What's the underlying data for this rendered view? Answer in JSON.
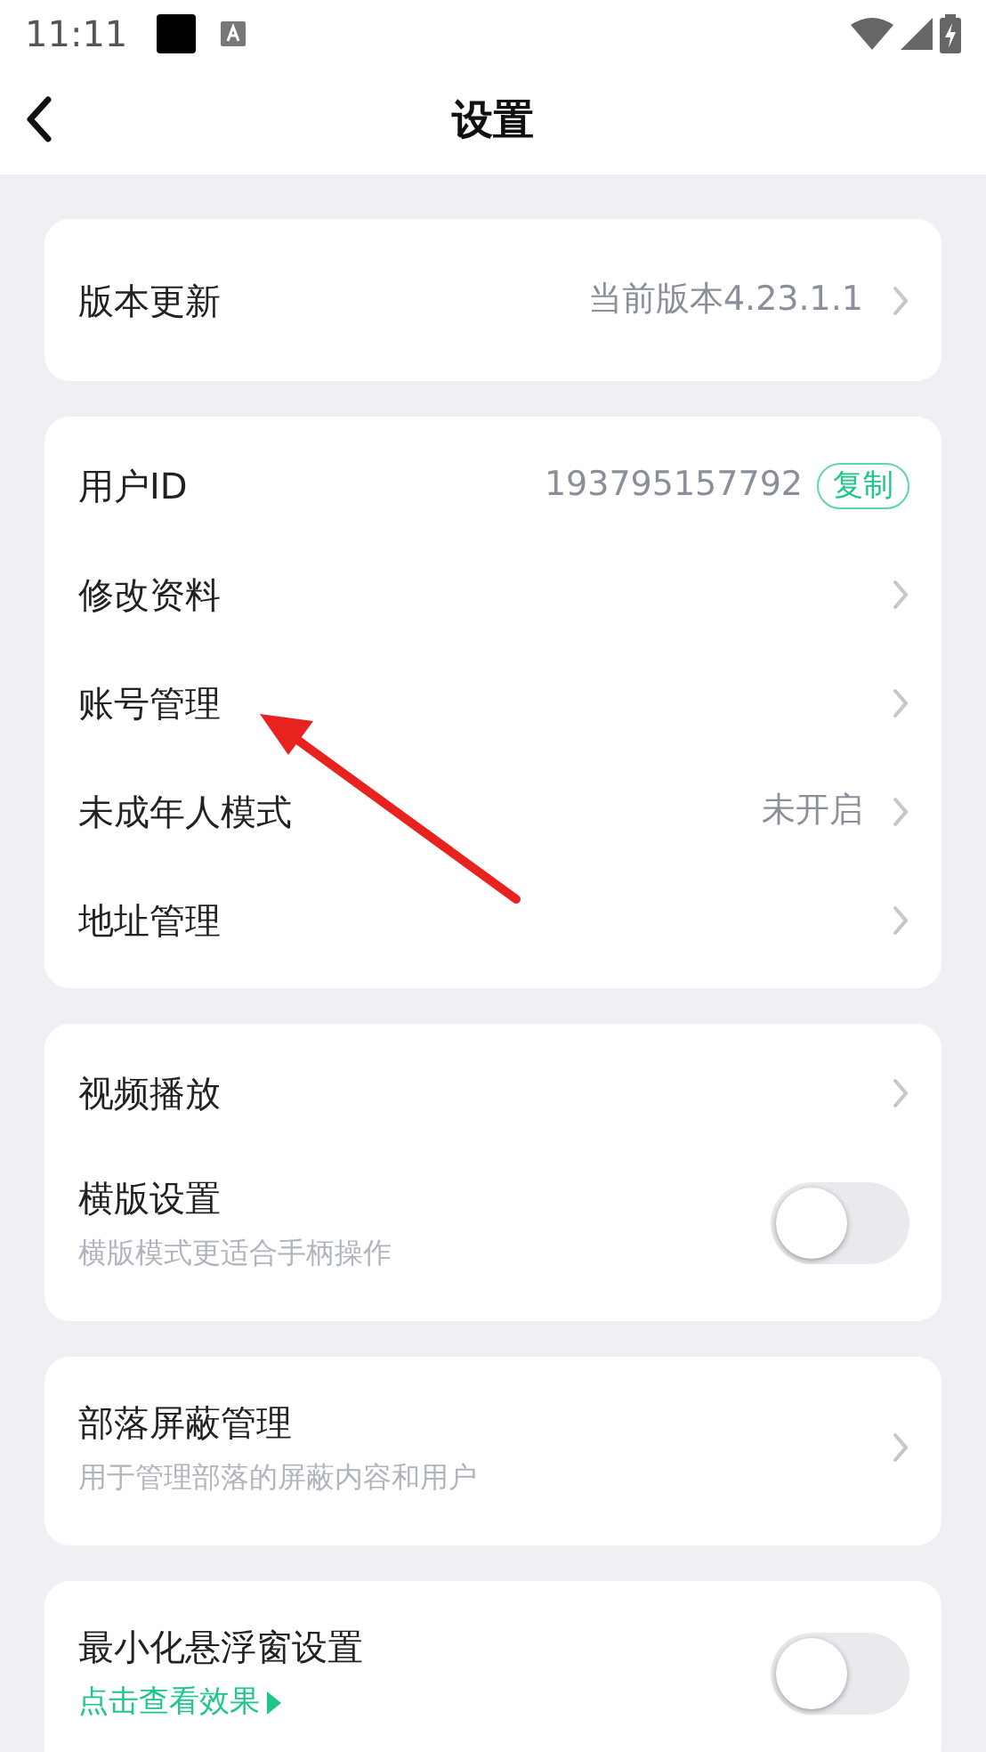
{
  "status_bar": {
    "time": "11:11"
  },
  "header": {
    "title": "设置"
  },
  "sections": [
    {
      "items": [
        {
          "kind": "link",
          "label": "版本更新",
          "value": "当前版本4.23.1.1"
        }
      ]
    },
    {
      "items": [
        {
          "kind": "copy",
          "label": "用户ID",
          "value": "193795157792",
          "badge": "复制"
        },
        {
          "kind": "link",
          "label": "修改资料"
        },
        {
          "kind": "link",
          "label": "账号管理"
        },
        {
          "kind": "link",
          "label": "未成年人模式",
          "value": "未开启"
        },
        {
          "kind": "link",
          "label": "地址管理"
        }
      ]
    },
    {
      "items": [
        {
          "kind": "link",
          "label": "视频播放"
        },
        {
          "kind": "toggle",
          "label": "横版设置",
          "subtitle": "横版模式更适合手柄操作",
          "on": false
        }
      ]
    },
    {
      "items": [
        {
          "kind": "link",
          "label": "部落屏蔽管理",
          "subtitle": "用于管理部落的屏蔽内容和用户"
        }
      ]
    },
    {
      "items": [
        {
          "kind": "toggle",
          "label": "最小化悬浮窗设置",
          "hint_link": "点击查看效果",
          "on": false
        }
      ]
    }
  ]
}
